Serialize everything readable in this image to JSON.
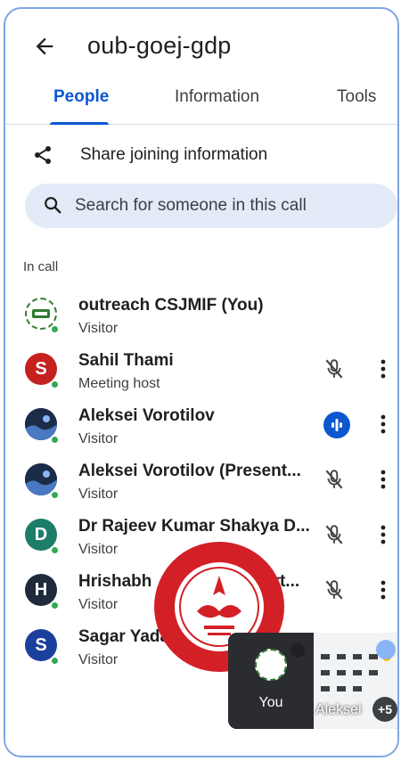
{
  "header": {
    "title": "oub-goej-gdp"
  },
  "tabs": [
    {
      "label": "People"
    },
    {
      "label": "Information"
    },
    {
      "label": "Tools"
    }
  ],
  "share": {
    "label": "Share joining information"
  },
  "search": {
    "placeholder": "Search for someone in this call"
  },
  "section": {
    "label": "In call"
  },
  "participants": [
    {
      "name": "outreach CSJMIF (You)",
      "role": "Visitor",
      "initial": "",
      "avatar_color": "#ffffff",
      "mic": "none"
    },
    {
      "name": "Sahil Thami",
      "role": "Meeting host",
      "initial": "S",
      "avatar_color": "#c5221f",
      "mic": "muted"
    },
    {
      "name": "Aleksei Vorotilov",
      "role": "Visitor",
      "initial": "",
      "avatar_color": "#1b2c48",
      "mic": "speaking"
    },
    {
      "name": "Aleksei Vorotilov (Present...",
      "role": "Visitor",
      "initial": "",
      "avatar_color": "#1b2c48",
      "mic": "muted"
    },
    {
      "name": "Dr Rajeev Kumar Shakya D...",
      "role": "Visitor",
      "initial": "D",
      "avatar_color": "#1e7d68",
      "mic": "muted"
    },
    {
      "name": "Hrishabh",
      "name_tail": "art...",
      "role": "Visitor",
      "initial": "H",
      "avatar_color": "#1f2a3a",
      "mic": "muted"
    },
    {
      "name": "Sagar Yada",
      "role": "Visitor",
      "initial": "S",
      "avatar_color": "#1a3f9c",
      "mic": "none"
    }
  ],
  "tile": {
    "you_label": "You",
    "share_label": "Aleksei",
    "badge": "+5"
  },
  "colors": {
    "accent": "#0b57d0",
    "online": "#34a853",
    "search_bg": "#e3ebf8"
  }
}
